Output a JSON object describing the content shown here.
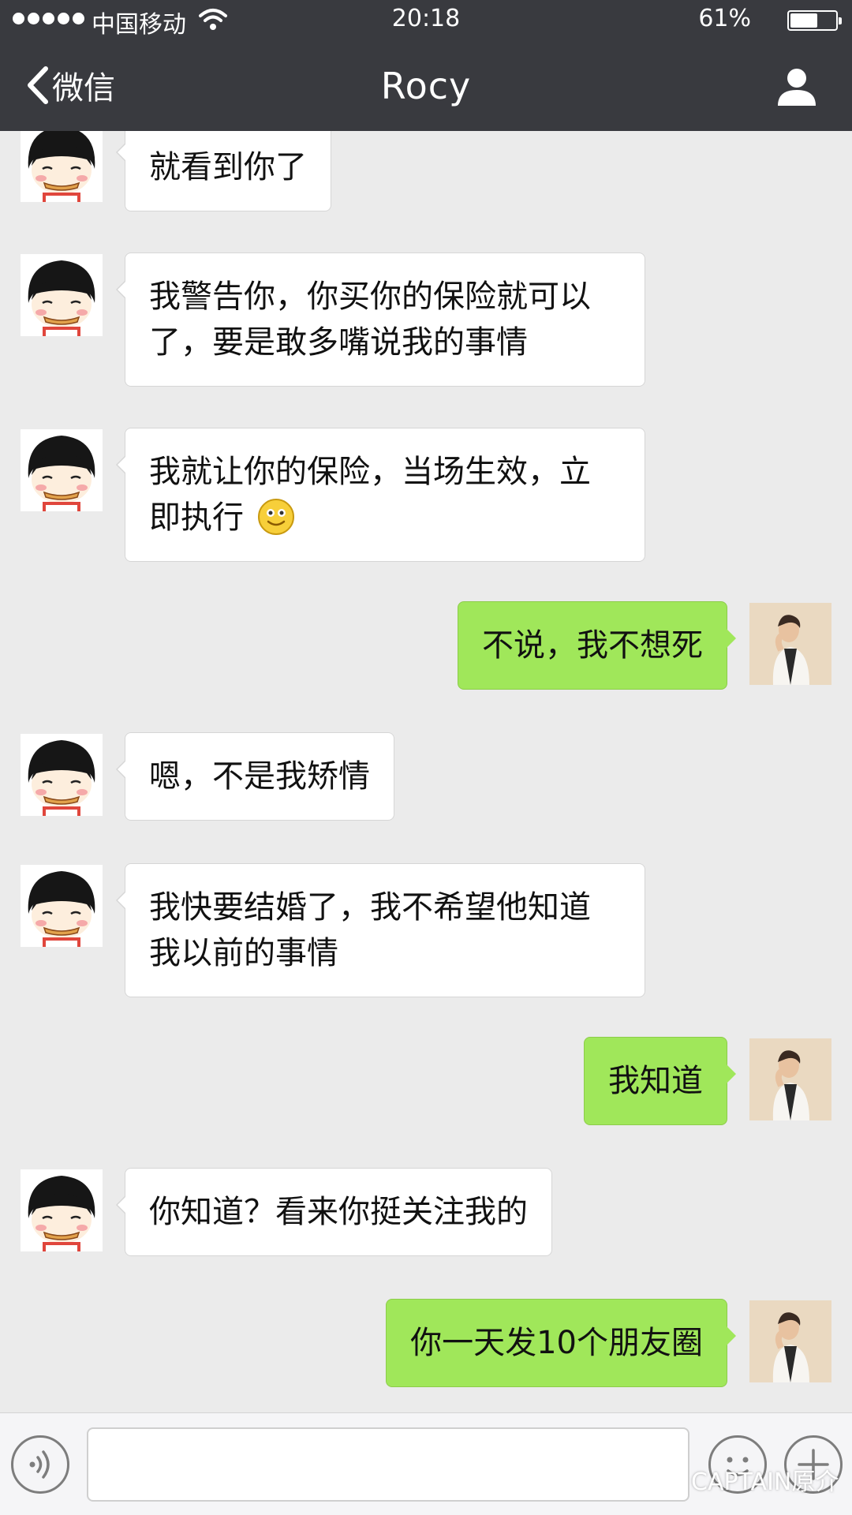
{
  "status_bar": {
    "carrier": "中国移动",
    "time": "20:18",
    "battery_percent": "61%",
    "battery_level": 0.61
  },
  "nav": {
    "back_label": "微信",
    "title": "Rocy"
  },
  "messages": [
    {
      "side": "in",
      "text": "就看到你了"
    },
    {
      "side": "in",
      "text": "我警告你，你买你的保险就可以了，要是敢多嘴说我的事情"
    },
    {
      "side": "in",
      "text": "我就让你的保险，当场生效，立即执行"
    },
    {
      "side": "out",
      "text": "不说，我不想死"
    },
    {
      "side": "in",
      "text": "嗯，不是我矫情"
    },
    {
      "side": "in",
      "text": "我快要结婚了，我不希望他知道我以前的事情"
    },
    {
      "side": "out",
      "text": "我知道"
    },
    {
      "side": "in",
      "text": "你知道？看来你挺关注我的"
    },
    {
      "side": "out",
      "text": "你一天发10个朋友圈"
    }
  ],
  "input": {
    "value": "",
    "placeholder": ""
  },
  "watermark": "CAPTAIN原介",
  "colors": {
    "header_bg": "#393a3f",
    "chat_bg": "#ebebeb",
    "incoming_bubble": "#ffffff",
    "outgoing_bubble": "#a0e75a"
  }
}
